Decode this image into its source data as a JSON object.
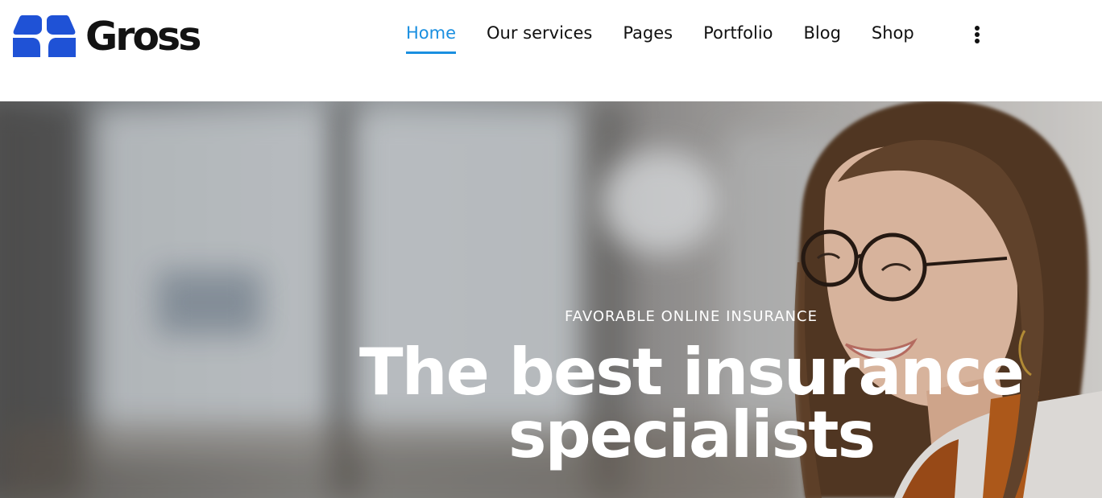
{
  "brand": {
    "name": "Gross",
    "logo_icon": "gross-logo-mark",
    "logo_color": "#1f52d6"
  },
  "nav": {
    "items": [
      {
        "label": "Home",
        "active": true
      },
      {
        "label": "Our services",
        "active": false
      },
      {
        "label": "Pages",
        "active": false
      },
      {
        "label": "Portfolio",
        "active": false
      },
      {
        "label": "Blog",
        "active": false
      },
      {
        "label": "Shop",
        "active": false
      }
    ],
    "more_icon": "vertical-ellipsis-icon",
    "active_color": "#1a8fe0"
  },
  "hero": {
    "eyebrow": "FAVORABLE ONLINE INSURANCE",
    "title": "The best insurance specialists"
  }
}
